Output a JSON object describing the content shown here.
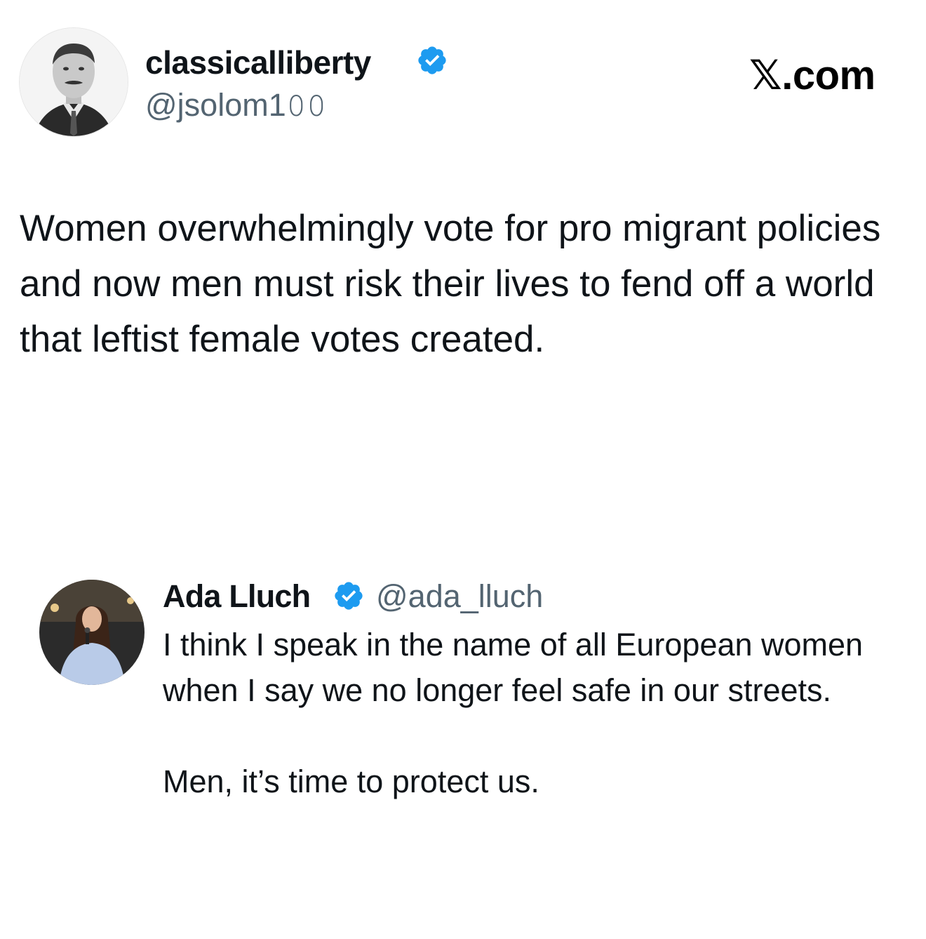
{
  "colors": {
    "verified_badge": "#1d9bf0",
    "handle_text": "#536471",
    "body_text": "#0f1419"
  },
  "brand": {
    "label": "𝕏.com"
  },
  "main_post": {
    "display_name": "classicalliberty",
    "handle": "@jsolom1𝟶𝟶",
    "verified_icon": "verified-badge-icon",
    "text": "Women overwhelmingly vote for pro migrant policies and now men must risk their lives to fend off a world that leftist female votes created."
  },
  "quoted_post": {
    "display_name": "Ada Lluch",
    "handle": "@ada_lluch",
    "verified_icon": "verified-badge-icon",
    "paragraphs": [
      "I think I speak in the name of all European women when I say we no longer feel safe in our streets.",
      "Men, it’s time to protect us."
    ]
  }
}
